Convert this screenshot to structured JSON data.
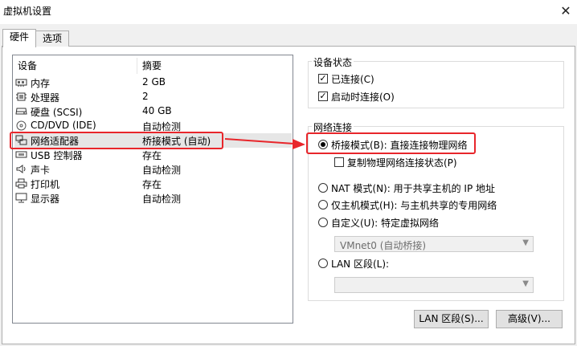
{
  "window": {
    "title": "虚拟机设置",
    "close_glyph": "✕"
  },
  "tabs": [
    {
      "label": "硬件",
      "active": true
    },
    {
      "label": "选项",
      "active": false
    }
  ],
  "device_list": {
    "headers": {
      "device": "设备",
      "summary": "摘要"
    },
    "rows": [
      {
        "icon": "memory-icon",
        "name": "内存",
        "summary": "2 GB"
      },
      {
        "icon": "processor-icon",
        "name": "处理器",
        "summary": "2"
      },
      {
        "icon": "hard-disk-icon",
        "name": "硬盘 (SCSI)",
        "summary": "40 GB"
      },
      {
        "icon": "cd-dvd-icon",
        "name": "CD/DVD (IDE)",
        "summary": "自动检测"
      },
      {
        "icon": "network-adapter-icon",
        "name": "网络适配器",
        "summary": "桥接模式 (自动)",
        "selected": true
      },
      {
        "icon": "usb-icon",
        "name": "USB 控制器",
        "summary": "存在"
      },
      {
        "icon": "sound-card-icon",
        "name": "声卡",
        "summary": "自动检测"
      },
      {
        "icon": "printer-icon",
        "name": "打印机",
        "summary": "存在"
      },
      {
        "icon": "display-icon",
        "name": "显示器",
        "summary": "自动检测"
      }
    ]
  },
  "device_status": {
    "group_label": "设备状态",
    "connected": {
      "label": "已连接(C)",
      "checked": true
    },
    "connect_at_power_on": {
      "label": "启动时连接(O)",
      "checked": true
    }
  },
  "network_connection": {
    "group_label": "网络连接",
    "bridged": {
      "label": "桥接模式(B): 直接连接物理网络",
      "selected": true
    },
    "replicate_state": {
      "label": "复制物理网络连接状态(P)",
      "checked": false
    },
    "nat": {
      "label": "NAT 模式(N): 用于共享主机的 IP 地址",
      "selected": false
    },
    "host_only": {
      "label": "仅主机模式(H): 与主机共享的专用网络",
      "selected": false
    },
    "custom": {
      "label": "自定义(U): 特定虚拟网络",
      "selected": false
    },
    "custom_select": {
      "value": "VMnet0 (自动桥接)"
    },
    "lan_segment": {
      "label": "LAN 区段(L):",
      "selected": false
    },
    "lan_select": {
      "value": ""
    }
  },
  "buttons": {
    "lan_segments": "LAN 区段(S)...",
    "advanced": "高级(V)..."
  },
  "annotation": {
    "color": "#e8262b"
  }
}
